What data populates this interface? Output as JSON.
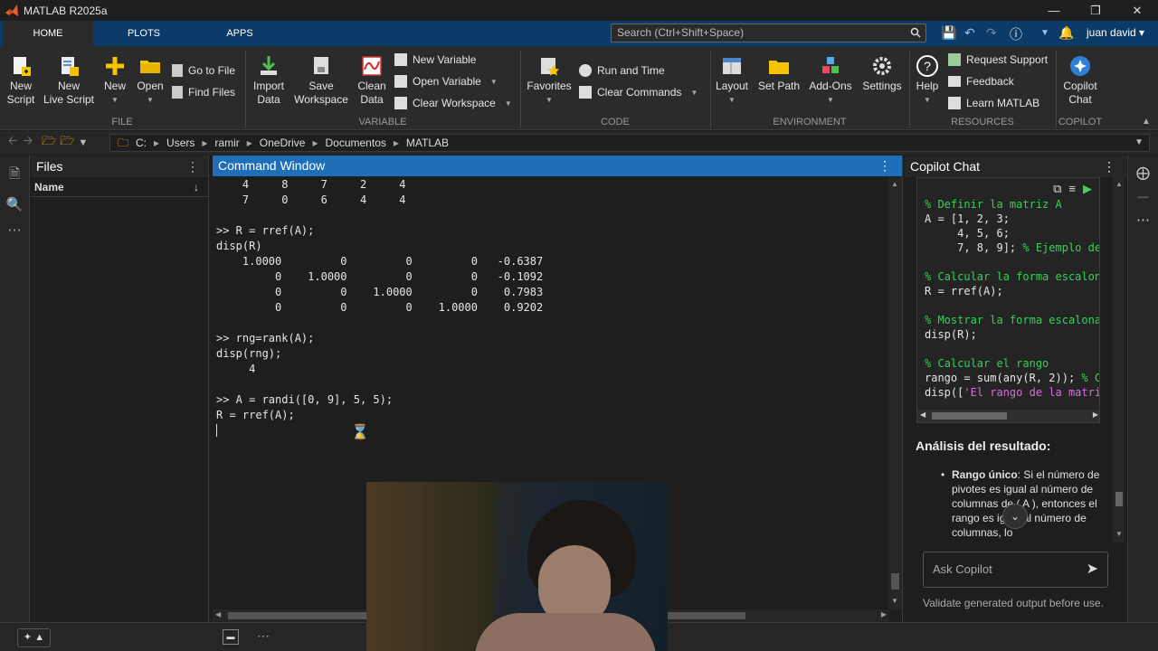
{
  "titlebar": {
    "title": "MATLAB R2025a"
  },
  "tabs": {
    "home": "HOME",
    "plots": "PLOTS",
    "apps": "APPS"
  },
  "search": {
    "placeholder": "Search (Ctrl+Shift+Space)"
  },
  "user": {
    "name": "juan david"
  },
  "ribbon": {
    "file": {
      "new_script": "New\nScript",
      "new_live_script": "New\nLive Script",
      "new": "New",
      "open": "Open",
      "go_to_file": "Go to File",
      "find_files": "Find Files",
      "label": "FILE"
    },
    "variable": {
      "import_data": "Import\nData",
      "save_workspace": "Save\nWorkspace",
      "clean_data": "Clean\nData",
      "new_variable": "New Variable",
      "open_variable": "Open Variable",
      "clear_workspace": "Clear Workspace",
      "label": "VARIABLE"
    },
    "code": {
      "favorites": "Favorites",
      "run_and_time": "Run and Time",
      "clear_commands": "Clear Commands",
      "label": "CODE"
    },
    "environment": {
      "layout": "Layout",
      "set_path": "Set Path",
      "add_ons": "Add-Ons",
      "settings": "Settings",
      "label": "ENVIRONMENT"
    },
    "resources": {
      "help": "Help",
      "request_support": "Request Support",
      "feedback": "Feedback",
      "learn_matlab": "Learn MATLAB",
      "label": "RESOURCES"
    },
    "copilot": {
      "copilot_chat": "Copilot\nChat",
      "label": "COPILOT"
    }
  },
  "address": {
    "segments": [
      "C:",
      "Users",
      "ramir",
      "OneDrive",
      "Documentos",
      "MATLAB"
    ]
  },
  "files_panel": {
    "title": "Files",
    "column": "Name"
  },
  "command_window": {
    "title": "Command Window",
    "lines": [
      "    4     8     7     2     4",
      "    7     0     6     4     4",
      "",
      ">> R = rref(A);",
      "disp(R)",
      "    1.0000         0         0         0   -0.6387",
      "         0    1.0000         0         0   -0.1092",
      "         0         0    1.0000         0    0.7983",
      "         0         0         0    1.0000    0.9202",
      "",
      ">> rng=rank(A);",
      "disp(rng);",
      "     4",
      "",
      ">> A = randi([0, 9], 5, 5);",
      "R = rref(A);"
    ]
  },
  "copilot_chat": {
    "title": "Copilot Chat",
    "code": [
      {
        "text": "% Definir la matriz A",
        "kind": "comment"
      },
      {
        "text": "A = [1, 2, 3;",
        "kind": "code"
      },
      {
        "text": "     4, 5, 6;",
        "kind": "code"
      },
      {
        "text": "     7, 8, 9]; % Ejemplo de",
        "kind": "mixed"
      },
      {
        "text": "",
        "kind": "code"
      },
      {
        "text": "% Calcular la forma escalon",
        "kind": "comment"
      },
      {
        "text": "R = rref(A);",
        "kind": "code"
      },
      {
        "text": "",
        "kind": "code"
      },
      {
        "text": "% Mostrar la forma escalona",
        "kind": "comment"
      },
      {
        "text": "disp(R);",
        "kind": "code"
      },
      {
        "text": "",
        "kind": "code"
      },
      {
        "text": "% Calcular el rango",
        "kind": "comment"
      },
      {
        "text": "rango = sum(any(R, 2)); % C",
        "kind": "mixed"
      },
      {
        "text": "disp(['El rango de la matri",
        "kind": "string"
      }
    ],
    "analysis_title": "Análisis del resultado:",
    "analysis_term": "Rango único",
    "analysis_text": ": Si el número de pivotes es igual al número de columnas de ( A ), entonces el rango es igual al número de columnas, lo",
    "ask_placeholder": "Ask Copilot",
    "disclaimer": "Validate generated output before use."
  },
  "colors": {
    "tab_strip": "#0c3b6a",
    "command_header": "#1f6fb8",
    "comment_green": "#34d15a",
    "string_magenta": "#d36fd8",
    "background": "#1e1e1e"
  }
}
